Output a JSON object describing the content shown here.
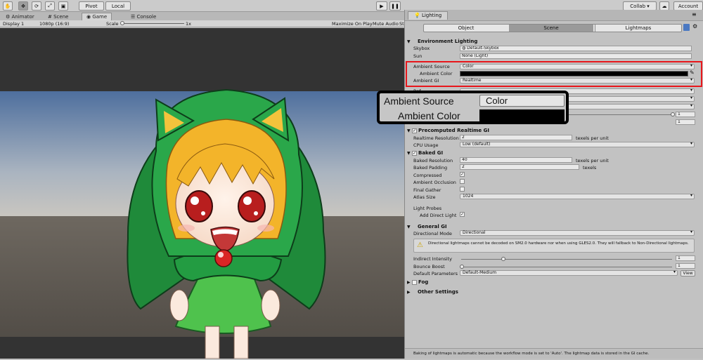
{
  "toolbar": {
    "pivot": "Pivot",
    "local": "Local",
    "collab": "Collab ▾",
    "account": "Account"
  },
  "game_tabs": [
    "Animator",
    "Scene",
    "Game",
    "Console"
  ],
  "game_bar": {
    "display": "Display 1",
    "resolution": "1080p (16:9)",
    "scale_label": "Scale",
    "scale_value": "1x",
    "maximize": "Maximize On Play",
    "mute": "Mute Audio",
    "stats": "St"
  },
  "lighting": {
    "title": "Lighting",
    "tabs": [
      "Object",
      "Scene",
      "Lightmaps"
    ],
    "env_title": "Environment Lighting",
    "skybox_label": "Skybox",
    "skybox_value": "Default-Skybox",
    "sun_label": "Sun",
    "sun_value": "None (Light)",
    "ambient_source_label": "Ambient Source",
    "ambient_source_value": "Color",
    "ambient_color_label": "Ambient Color",
    "ambient_gi_label": "Ambient GI",
    "ambient_gi_value": "Realtime",
    "refl_row1": "Ref",
    "refl_val1": "1",
    "refl_val2": "1",
    "precomp_title": "Precomputed Realtime GI",
    "rt_res_label": "Realtime Resolution",
    "rt_res_value": "2",
    "texels": "texels per unit",
    "cpu_label": "CPU Usage",
    "cpu_value": "Low (default)",
    "baked_title": "Baked GI",
    "baked_res_label": "Baked Resolution",
    "baked_res_value": "40",
    "baked_pad_label": "Baked Padding",
    "baked_pad_value": "2",
    "texels_short": "texels",
    "compressed_label": "Compressed",
    "ao_label": "Ambient Occlusion",
    "final_gather_label": "Final Gather",
    "atlas_label": "Atlas Size",
    "atlas_value": "1024",
    "light_probes_label": "Light Probes",
    "add_direct_label": "Add Direct Light",
    "general_title": "General GI",
    "dir_mode_label": "Directional Mode",
    "dir_mode_value": "Directional",
    "warning": "Directional lightmaps cannot be decoded on SM2.0 hardware nor when using GLES2.0. They will fallback to Non-Directional lightmaps.",
    "indirect_label": "Indirect Intensity",
    "indirect_value": "1",
    "bounce_label": "Bounce Boost",
    "bounce_value": "1",
    "defparams_label": "Default Parameters",
    "defparams_value": "Default-Medium",
    "view_button": "View",
    "fog_label": "Fog",
    "other_label": "Other Settings",
    "footer": "Baking of lightmaps is automatic because the workflow mode is set to 'Auto'. The lightmap data is stored in the GI cache."
  },
  "zoom_callout": {
    "ambient_source_label": "Ambient Source",
    "ambient_source_value": "Color",
    "ambient_color_label": "Ambient Color"
  },
  "colors": {
    "highlight_red": "#e8161b",
    "callout_border": "#000000",
    "ambient_color": "#000000",
    "hood_green": "#2a9e45",
    "sky_blue": "#5e7ea8"
  }
}
